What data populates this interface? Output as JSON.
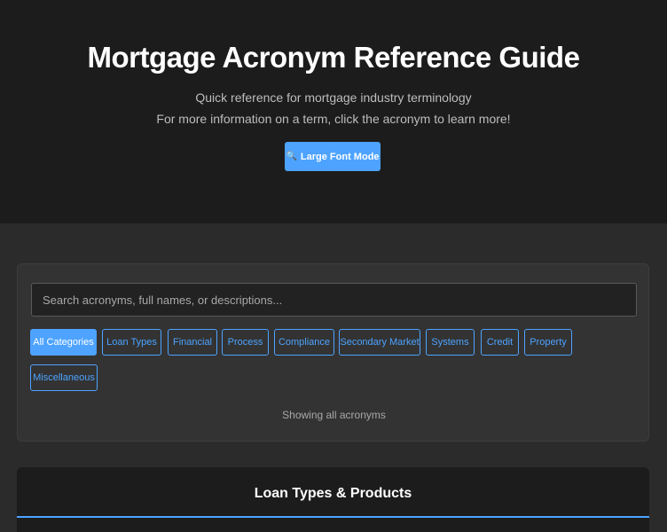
{
  "header": {
    "title": "Mortgage Acronym Reference Guide",
    "subtitle": "Quick reference for mortgage industry terminology",
    "subtitle2": "For more information on a term, click the acronym to learn more!",
    "font_button": {
      "icon": "🔍",
      "label": "Large Font Mode"
    }
  },
  "search": {
    "placeholder": "Search acronyms, full names, or descriptions...",
    "value": ""
  },
  "filters": [
    {
      "label": "All Categories",
      "active": true
    },
    {
      "label": "Loan Types",
      "active": false
    },
    {
      "label": "Financial",
      "active": false
    },
    {
      "label": "Process",
      "active": false
    },
    {
      "label": "Compliance",
      "active": false
    },
    {
      "label": "Secondary Market",
      "active": false
    },
    {
      "label": "Systems",
      "active": false
    },
    {
      "label": "Credit",
      "active": false
    },
    {
      "label": "Property",
      "active": false
    },
    {
      "label": "Miscellaneous",
      "active": false
    }
  ],
  "status": "Showing all acronyms",
  "sections": [
    {
      "title": "Loan Types & Products"
    }
  ],
  "colors": {
    "accent": "#4da3ff",
    "header_bg": "#1c1c1c",
    "page_bg": "#2b2b2b",
    "panel_bg": "#333333"
  }
}
